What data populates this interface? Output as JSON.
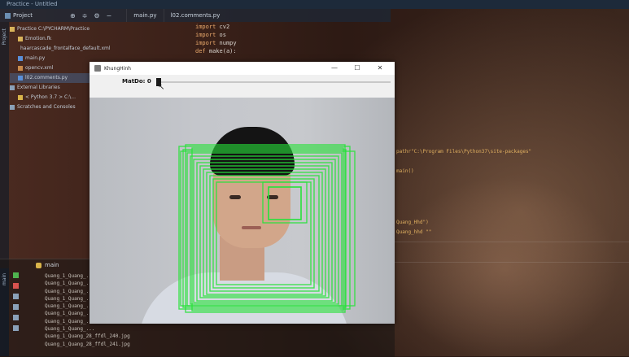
{
  "ide": {
    "title": "Practice - Untitled",
    "toolbar_tab": "Project",
    "editor_tabs": [
      "main.py",
      "l02.comments.py"
    ],
    "tree": [
      "Practice C:\\PYCHARM\\Practice",
      "Emotion.fk",
      "haarcascade_frontalface_default.xml",
      "main.py",
      "opencv.xml",
      "l02.comments.py",
      "External Libraries",
      "< Python 3.7 > C:\\...",
      "Scratches and Consoles"
    ],
    "code": [
      {
        "kw": "import",
        "txt": "cv2"
      },
      {
        "kw": "import",
        "txt": "os"
      },
      {
        "kw": "import",
        "txt": "numpy"
      },
      {
        "kw": "def",
        "txt": "make(a):"
      }
    ],
    "code_right": [
      "pathr\"C:\\Program Files\\Python37\\site-packages\"",
      "main()",
      "Quang_Hhd\")",
      "Quang_hhd \"\""
    ],
    "run_tab": "main",
    "console": [
      "Quang_1_Quang_...",
      "Quang_1_Quang_...",
      "Quang_1_Quang_...",
      "Quang_1_Quang_...",
      "Quang_1_Quang_...",
      "Quang_1_Quang_...",
      "Quang_1_Quang_...",
      "Quang_1_Quang_...",
      "Quang_1_Quang_28_ffdl_240.jpg",
      "Quang_1_Quang_28_ffdl_241.jpg"
    ]
  },
  "cv_window": {
    "title": "KhungHinh",
    "controls": [
      "—",
      "☐",
      "✕"
    ],
    "trackbar_label": "MatDo: 0",
    "trackbar_value": 0
  },
  "colors": {
    "detection_box": "#27e23a",
    "ide_panel": "#1d2a3a"
  }
}
